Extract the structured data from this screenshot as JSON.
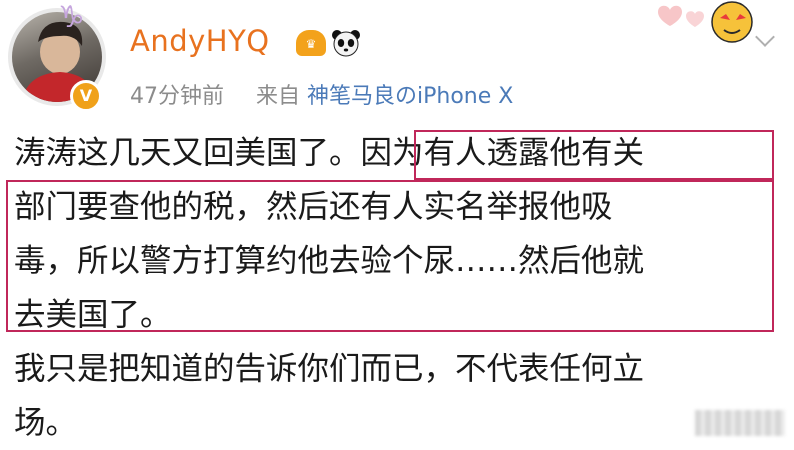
{
  "header": {
    "username": "AndyHYQ",
    "zodiac": "♑",
    "time_ago": "47分钟前",
    "source_prefix": "来自",
    "source_device": "神笔马良のiPhone X"
  },
  "post": {
    "lines": [
      "涛涛这几天又回美国了。",
      "因为有人透露他有关",
      "部门要查他的税，然后还有人实名举报他吸",
      "毒，所以警方打算约他去验个尿……然后他就",
      "去美国了。",
      "我只是把知道的告诉你们而已，不代表任何立",
      "场。"
    ]
  },
  "colors": {
    "username": "#e8721f",
    "source_link": "#4b7ab8",
    "highlight_box": "#c0275a",
    "meta_text": "#8c8c8c"
  },
  "icons": {
    "verified": "verified-v-icon",
    "vip": "vip-crown-icon",
    "panda": "panda-icon",
    "sticker": "cartoon-face-sticker-icon",
    "menu": "chevron-down-icon"
  }
}
